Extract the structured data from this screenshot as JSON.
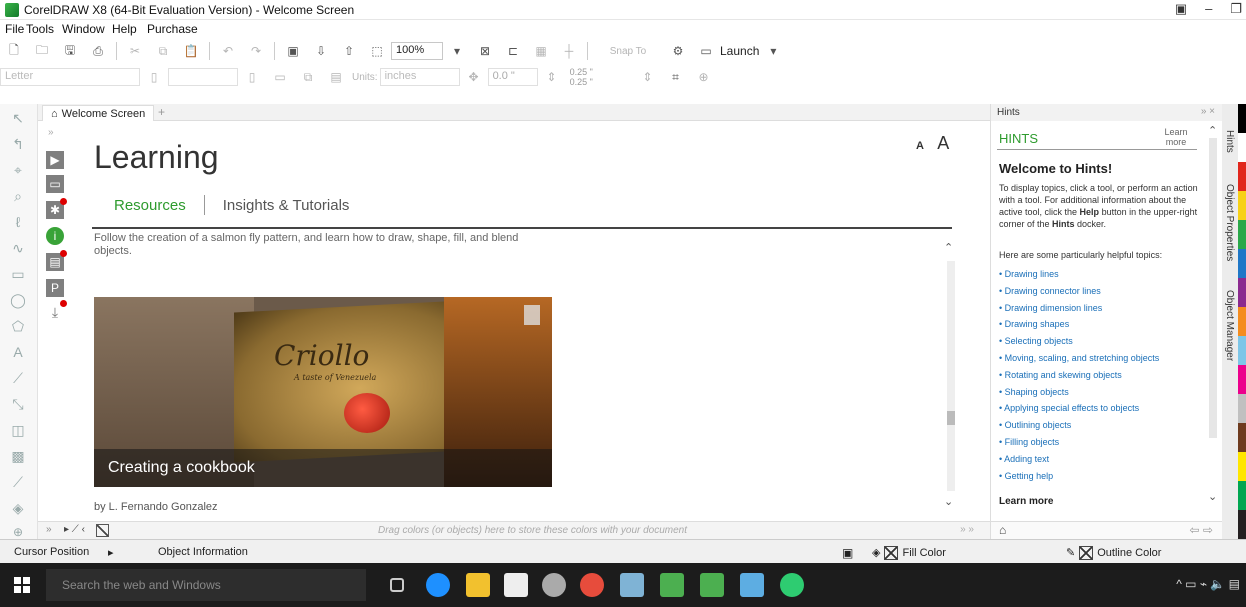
{
  "window": {
    "title": "CorelDRAW X8 (64-Bit Evaluation Version) - Welcome Screen"
  },
  "menu": {
    "items": [
      "File",
      "Tools",
      "Window",
      "Help",
      "Purchase"
    ]
  },
  "toolbar": {
    "zoom": "100%",
    "snap_to": "Snap To",
    "launch": "Launch"
  },
  "propertybar": {
    "page_size": "Letter",
    "units_label": "Units:",
    "units_value": "inches",
    "nudge": "0.0 \"",
    "dup_x": "0.25 \"",
    "dup_y": "0.25 \""
  },
  "tab": {
    "label": "Welcome Screen"
  },
  "welcome": {
    "heading": "Learning",
    "subtab_active": "Resources",
    "subtab_other": "Insights & Tutorials",
    "description": "Follow the creation of a salmon fly pattern, and learn how to draw, shape, fill, and blend objects.",
    "font_small": "A",
    "font_large": "A",
    "card": {
      "book_title": "Criollo",
      "book_subtitle": "A taste of Venezuela",
      "caption": "Creating a cookbook"
    },
    "author": "by L. Fernando Gonzalez"
  },
  "palette_bar": {
    "hint": "Drag colors (or objects) here to store these colors with your document"
  },
  "hints": {
    "docker_title": "Hints",
    "caption": "HINTS",
    "learn_more_top": "Learn more",
    "welcome_title": "Welcome to Hints!",
    "para1_a": "To display topics, click a tool, or perform an action with a tool. For additional information about the active tool, click the ",
    "para1_help": "Help",
    "para1_b": " button in the upper-right corner of the ",
    "para1_hints": "Hints",
    "para1_c": " docker.",
    "para2": "Here are some particularly helpful topics:",
    "topics": [
      "Drawing lines",
      "Drawing connector lines",
      "Drawing dimension lines",
      "Drawing shapes",
      "Selecting objects",
      "Moving, scaling, and stretching objects",
      "Rotating and skewing objects",
      "Shaping objects",
      "Applying special effects to objects",
      "Outlining objects",
      "Filling objects",
      "Adding text",
      "Getting help"
    ],
    "learn_more_bottom": "Learn more"
  },
  "docker_tabs": [
    "Hints",
    "Object Properties",
    "Object Manager"
  ],
  "status": {
    "cursor_position": "Cursor Position",
    "object_information": "Object Information",
    "fill_color": "Fill Color",
    "outline_color": "Outline Color"
  },
  "taskbar": {
    "search_placeholder": "Search the web and Windows"
  },
  "palette_colors": [
    "#000000",
    "#ffffff",
    "#e1261c",
    "#f7d117",
    "#2aa84a",
    "#1f77c7",
    "#8b2a8f",
    "#f48c1f",
    "#7dc6e8",
    "#ec008c",
    "#c0c0c0",
    "#6e3b1f",
    "#ffe600",
    "#00a651",
    "#231f20"
  ],
  "accent": "#2e9b2e"
}
